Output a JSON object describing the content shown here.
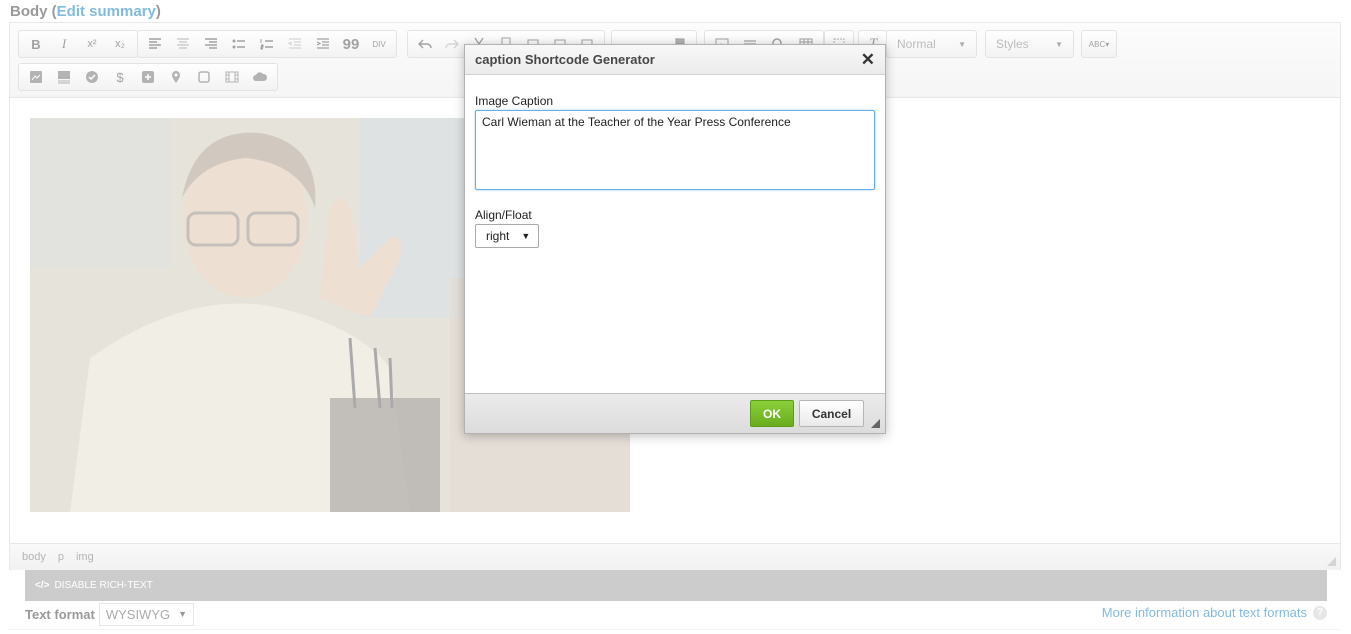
{
  "field": {
    "label": "Body",
    "edit_summary": "Edit summary"
  },
  "toolbar": {
    "row1_group1": [
      "B",
      "I",
      "x²",
      "x₂"
    ],
    "row1_group2": [
      "align-left",
      "align-center",
      "align-right",
      "bullet-list",
      "numbered-list",
      "outdent",
      "indent",
      "99",
      "DIV"
    ],
    "format_combo": "Normal",
    "styles_combo": "Styles",
    "spellcheck": "ABC"
  },
  "content": {
    "image_alt": "Carl Wieman photo"
  },
  "statusbar": {
    "path": [
      "body",
      "p",
      "img"
    ]
  },
  "richtext": {
    "toggle_label": "DISABLE RICH-TEXT"
  },
  "text_format": {
    "label": "Text format",
    "value": "WYSIWYG",
    "more_info": "More information about text formats"
  },
  "dialog": {
    "title": "caption Shortcode Generator",
    "caption_label": "Image Caption",
    "caption_value": "Carl Wieman at the Teacher of the Year Press Conference",
    "align_label": "Align/Float",
    "align_value": "right",
    "ok_label": "OK",
    "cancel_label": "Cancel"
  },
  "colors": {
    "ok_green": "#6aac1e",
    "link_blue": "#0074bd",
    "focus_blue": "#66afe9"
  }
}
